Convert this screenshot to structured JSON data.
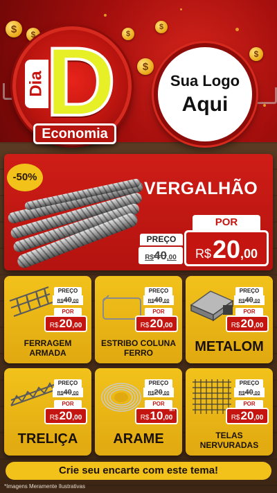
{
  "brand": {
    "logo_word_dia": "Dia",
    "logo_letter": "D",
    "logo_banner": "Economia"
  },
  "placeholder_logo": {
    "line1": "Sua Logo",
    "line2": "Aqui"
  },
  "hero": {
    "discount_badge": "-50%",
    "product_name": "VERGALHÃO",
    "old_label": "PREÇO",
    "old_currency": "R$",
    "old_int": "40",
    "old_dec": ",00",
    "new_label": "POR",
    "new_currency": "R$",
    "new_int": "20",
    "new_dec": ",00"
  },
  "products": [
    {
      "name": "FERRAGEM ARMADA",
      "old_label": "PREÇO",
      "old_currency": "R$",
      "old_int": "40",
      "old_dec": ",00",
      "new_label": "POR",
      "new_currency": "R$",
      "new_int": "20",
      "new_dec": ",00",
      "unit": "",
      "icon": "rebar-cage-icon"
    },
    {
      "name": "ESTRIBO COLUNA FERRO",
      "old_label": "PREÇO",
      "old_currency": "R$",
      "old_int": "40",
      "old_dec": ",00",
      "new_label": "POR",
      "new_currency": "R$",
      "new_int": "20",
      "new_dec": ",00",
      "unit": "",
      "icon": "stirrup-icon"
    },
    {
      "name": "METALOM",
      "old_label": "PREÇO",
      "old_currency": "R$",
      "old_int": "40",
      "old_dec": ",00",
      "new_label": "POR",
      "new_currency": "R$",
      "new_int": "20",
      "new_dec": ",00",
      "unit": "",
      "icon": "metal-tube-icon"
    },
    {
      "name": "TRELIÇA",
      "old_label": "PREÇO",
      "old_currency": "R$",
      "old_int": "40",
      "old_dec": ",00",
      "new_label": "POR",
      "new_currency": "R$",
      "new_int": "20",
      "new_dec": ",00",
      "unit": "",
      "icon": "truss-icon"
    },
    {
      "name": "ARAME",
      "old_label": "PREÇO",
      "old_currency": "R$",
      "old_int": "20",
      "old_dec": ",00",
      "new_label": "POR",
      "new_currency": "R$",
      "new_int": "10",
      "new_dec": ",00",
      "unit": "MT",
      "icon": "wire-coil-icon"
    },
    {
      "name": "TELAS NERVURADAS",
      "old_label": "PREÇO",
      "old_currency": "R$",
      "old_int": "40",
      "old_dec": ",00",
      "new_label": "POR",
      "new_currency": "R$",
      "new_int": "20",
      "new_dec": ",00",
      "unit": "",
      "icon": "mesh-icon"
    }
  ],
  "cta": "Crie seu encarte com este tema!",
  "disclaimer": "*Imagens Meramente Ilustrativas",
  "colors": {
    "red": "#c51510",
    "yellow": "#f2c21b",
    "logo_yellow": "#e7ef26",
    "wood": "#4b2f1b"
  }
}
